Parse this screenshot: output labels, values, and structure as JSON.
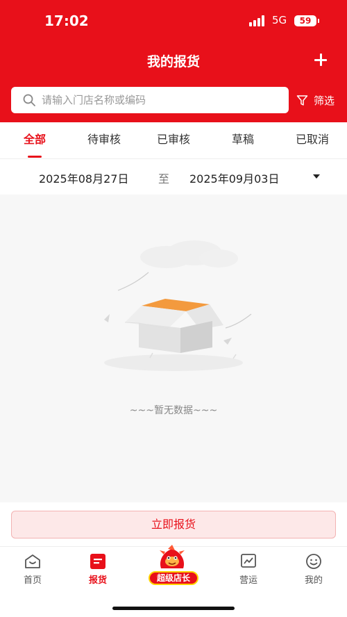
{
  "status_bar": {
    "time": "17:02",
    "network": "5G",
    "battery": "59"
  },
  "header": {
    "title": "我的报货",
    "add_icon": "plus-icon",
    "search_placeholder": "请输入门店名称或编码",
    "filter_label": "筛选",
    "accent_color": "#e8101a"
  },
  "tabs": [
    {
      "label": "全部",
      "active": true
    },
    {
      "label": "待审核"
    },
    {
      "label": "已审核"
    },
    {
      "label": "草稿"
    },
    {
      "label": "已取消"
    }
  ],
  "date_range": {
    "start": "2025年08月27日",
    "separator": "至",
    "end": "2025年09月03日"
  },
  "empty_state": {
    "text": "~~~暂无数据~~~",
    "icon": "empty-box-icon"
  },
  "action": {
    "report_now": "立即报货"
  },
  "tabbar": {
    "items": [
      {
        "label": "首页",
        "icon": "home-icon"
      },
      {
        "label": "报货",
        "icon": "report-icon",
        "active": true
      },
      {
        "label": "超级店长",
        "icon": "mascot-icon"
      },
      {
        "label": "营运",
        "icon": "chart-icon"
      },
      {
        "label": "我的",
        "icon": "smile-icon"
      }
    ]
  }
}
